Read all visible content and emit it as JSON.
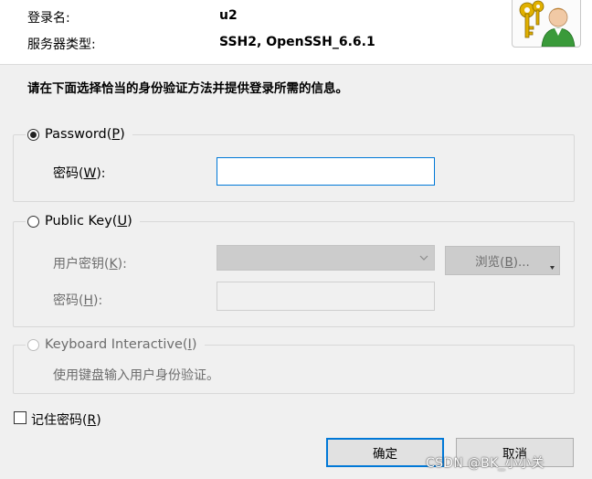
{
  "header": {
    "login_label": "登录名:",
    "login_value": "u2",
    "server_type_label": "服务器类型:",
    "server_type_value": "SSH2, OpenSSH_6.6.1"
  },
  "instruction": "请在下面选择恰当的身份验证方法并提供登录所需的信息。",
  "password_section": {
    "radio_label_prefix": "Password(",
    "radio_label_key": "P",
    "radio_label_suffix": ")",
    "selected": true,
    "field_label_prefix": "密码(",
    "field_label_key": "W",
    "field_label_suffix": "):",
    "field_value": ""
  },
  "public_key_section": {
    "radio_label_prefix": "Public Key(",
    "radio_label_key": "U",
    "radio_label_suffix": ")",
    "selected": false,
    "user_key_label_prefix": "用户密钥(",
    "user_key_label_key": "K",
    "user_key_label_suffix": "):",
    "user_key_value": "",
    "browse_label_prefix": "浏览(",
    "browse_label_key": "B",
    "browse_label_suffix": ")...",
    "passphrase_label_prefix": "密码(",
    "passphrase_label_key": "H",
    "passphrase_label_suffix": "):",
    "passphrase_value": ""
  },
  "keyboard_section": {
    "radio_label_prefix": "Keyboard Interactive(",
    "radio_label_key": "I",
    "radio_label_suffix": ")",
    "selected": false,
    "description": "使用键盘输入用户身份验证。"
  },
  "remember": {
    "label_prefix": "记住密码(",
    "label_key": "R",
    "label_suffix": ")",
    "checked": false
  },
  "buttons": {
    "ok": "确定",
    "cancel": "取消"
  },
  "watermark": "CSDN @BK_小小关",
  "colors": {
    "accent_border": "#0078d7",
    "disabled_text": "#6d6d6d",
    "dialog_bg": "#f0f0f0"
  }
}
